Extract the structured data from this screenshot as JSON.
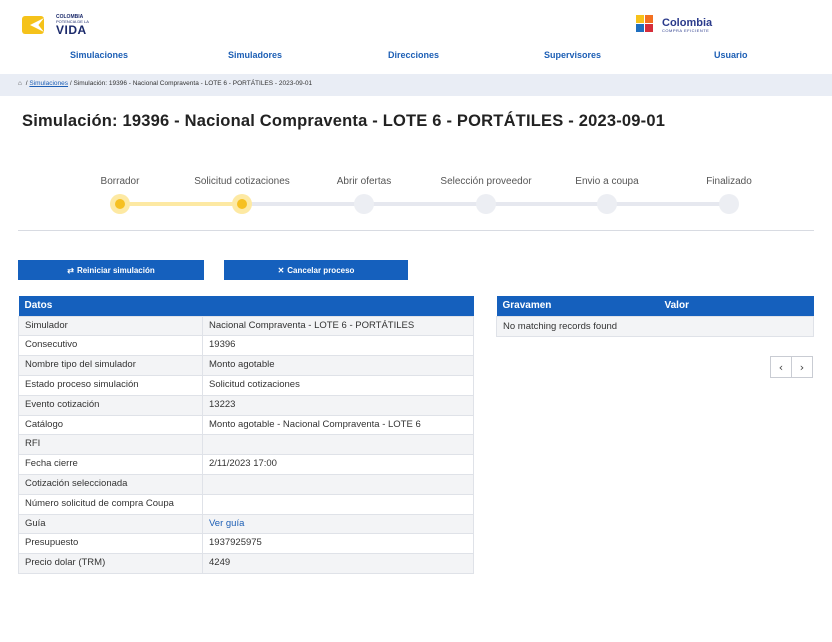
{
  "header": {
    "logo_left": {
      "line1": "COLOMBIA",
      "line2": "POTENCIA DE LA",
      "line3": "VIDA"
    },
    "logo_right": {
      "line1": "Colombia",
      "line2": "COMPRA EFICIENTE"
    }
  },
  "nav": [
    {
      "label": "Simulaciones"
    },
    {
      "label": "Simuladores"
    },
    {
      "label": "Direcciones"
    },
    {
      "label": "Supervisores"
    },
    {
      "label": "Usuario"
    }
  ],
  "breadcrumb": {
    "home_icon": "home-icon",
    "sep1": " / ",
    "link": "Simulaciones",
    "rest": " / Simulación: 19396 - Nacional Compraventa - LOTE 6 - PORTÁTILES - 2023-09-01"
  },
  "page_title": "Simulación: 19396 - Nacional Compraventa - LOTE 6 - PORTÁTILES - 2023-09-01",
  "stepper": {
    "steps": [
      {
        "label": "Borrador",
        "active": true
      },
      {
        "label": "Solicitud cotizaciones",
        "active": true
      },
      {
        "label": "Abrir ofertas",
        "active": false
      },
      {
        "label": "Selección proveedor",
        "active": false
      },
      {
        "label": "Envio a coupa",
        "active": false
      },
      {
        "label": "Finalizado",
        "active": false
      }
    ]
  },
  "actions": {
    "restart": {
      "icon": "⇄",
      "label": "Reiniciar simulación"
    },
    "cancel": {
      "icon": "✕",
      "label": "Cancelar proceso"
    }
  },
  "datos": {
    "header": "Datos",
    "rows": [
      {
        "key": "Simulador",
        "value": "Nacional Compraventa - LOTE 6 - PORTÁTILES"
      },
      {
        "key": "Consecutivo",
        "value": "19396"
      },
      {
        "key": "Nombre tipo del simulador",
        "value": "Monto agotable"
      },
      {
        "key": "Estado proceso simulación",
        "value": "Solicitud cotizaciones"
      },
      {
        "key": "Evento cotización",
        "value": "13223"
      },
      {
        "key": "Catálogo",
        "value": "Monto agotable - Nacional Compraventa - LOTE 6"
      },
      {
        "key": "RFI",
        "value": ""
      },
      {
        "key": "Fecha cierre",
        "value": "2/11/2023 17:00"
      },
      {
        "key": "Cotización seleccionada",
        "value": ""
      },
      {
        "key": "Número solicitud de compra Coupa",
        "value": ""
      },
      {
        "key": "Guía",
        "value": "Ver guía",
        "link": true
      },
      {
        "key": "Presupuesto",
        "value": "1937925975"
      },
      {
        "key": "Precio dolar (TRM)",
        "value": "4249"
      }
    ]
  },
  "gravamen": {
    "col1": "Gravamen",
    "col2": "Valor",
    "empty": "No matching records found"
  },
  "pager": {
    "prev": "‹",
    "next": "›"
  }
}
